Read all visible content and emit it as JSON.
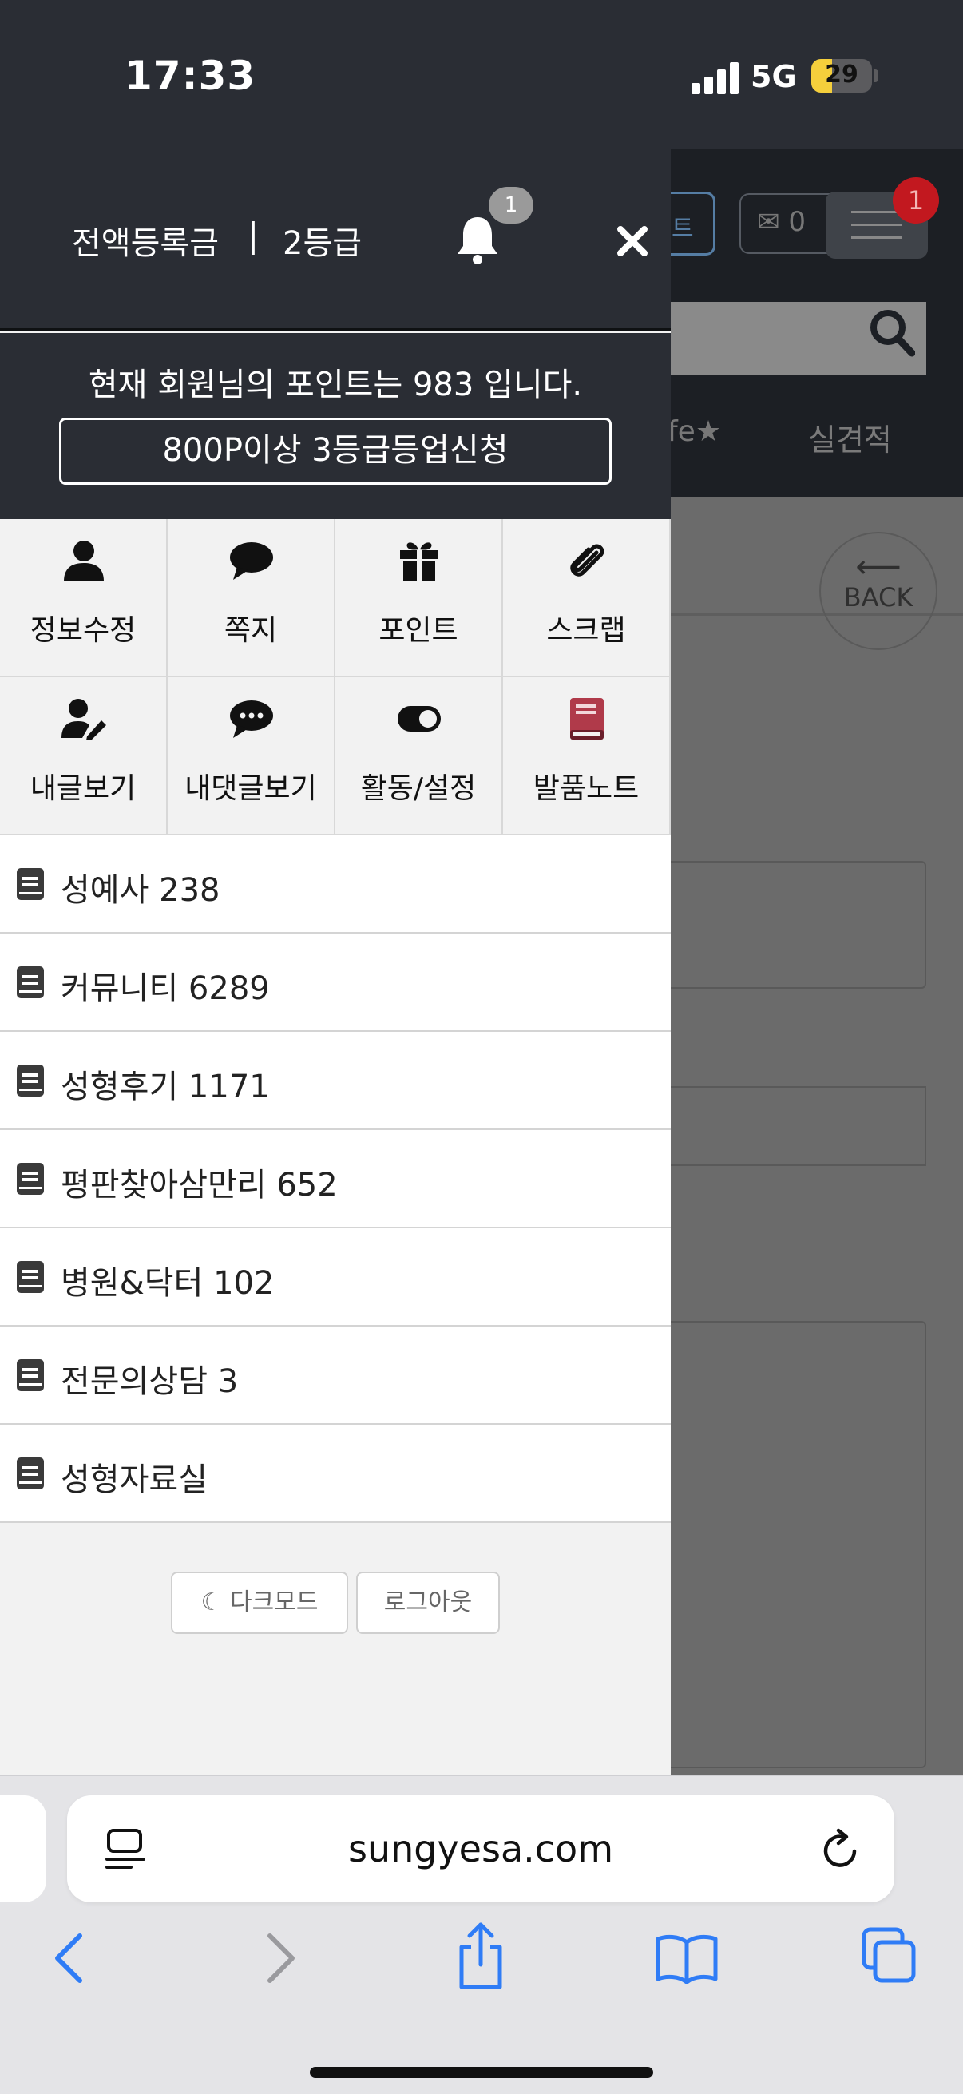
{
  "status_bar": {
    "time": "17:33",
    "network": "5G",
    "battery": "29"
  },
  "background_page": {
    "header_btn_text": "트",
    "message_count": "0",
    "menu_badge": "1",
    "nav_fav": "fe★",
    "nav_item": "실견적",
    "back_arrow": "⟵",
    "back_label": "BACK"
  },
  "drawer": {
    "user_name": "전액등록금",
    "separator": "|",
    "user_level": "2등급",
    "notification_count": "1",
    "points_text": "현재 회원님의 포인트는 983 입니다.",
    "upgrade_button": "800P이상 3등급등업신청",
    "menu": [
      {
        "label": "정보수정",
        "icon": "user-icon"
      },
      {
        "label": "쪽지",
        "icon": "chat-bubble-icon"
      },
      {
        "label": "포인트",
        "icon": "gift-icon"
      },
      {
        "label": "스크랩",
        "icon": "paperclip-icon"
      },
      {
        "label": "내글보기",
        "icon": "user-edit-icon"
      },
      {
        "label": "내댓글보기",
        "icon": "comment-dots-icon"
      },
      {
        "label": "활동/설정",
        "icon": "toggle-icon"
      },
      {
        "label": "발품노트",
        "icon": "notebook-icon"
      }
    ],
    "boards": [
      "성예사 238",
      "커뮤니티 6289",
      "성형후기 1171",
      "평판찾아삼만리 652",
      "병원&닥터 102",
      "전문의상담 3",
      "성형자료실"
    ],
    "darkmode_button": "다크모드",
    "logout_button": "로그아웃"
  },
  "browser": {
    "url": "sungyesa.com"
  },
  "colors": {
    "drawer_header": "#2a2d34",
    "badge_red": "#c2181f",
    "ios_blue": "#2f7cf6",
    "notebook_red": "#b03a4a"
  }
}
